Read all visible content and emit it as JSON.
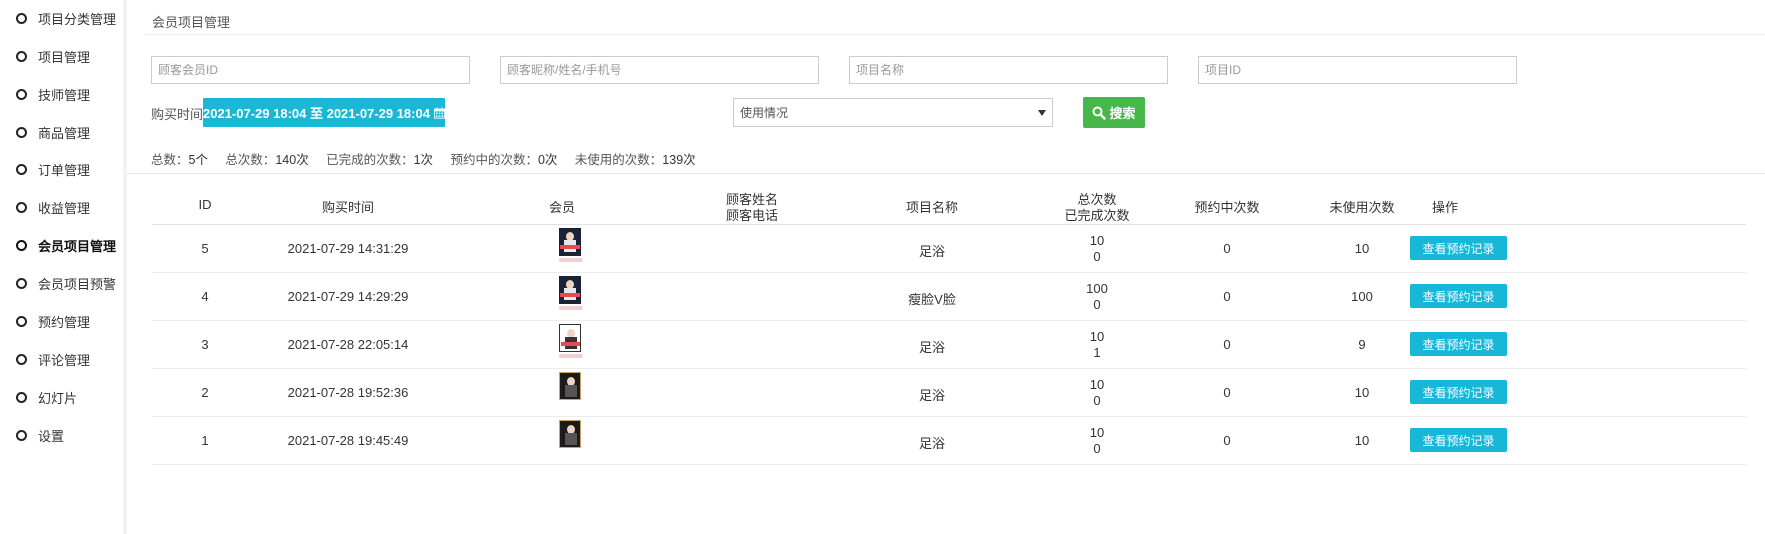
{
  "sidebar": {
    "items": [
      {
        "label": "项目分类管理",
        "active": false
      },
      {
        "label": "项目管理",
        "active": false
      },
      {
        "label": "技师管理",
        "active": false
      },
      {
        "label": "商品管理",
        "active": false
      },
      {
        "label": "订单管理",
        "active": false
      },
      {
        "label": "收益管理",
        "active": false
      },
      {
        "label": "会员项目管理",
        "active": true
      },
      {
        "label": "会员项目预警",
        "active": false
      },
      {
        "label": "预约管理",
        "active": false
      },
      {
        "label": "评论管理",
        "active": false
      },
      {
        "label": "幻灯片",
        "active": false
      },
      {
        "label": "设置",
        "active": false
      }
    ]
  },
  "page": {
    "title": "会员项目管理"
  },
  "filters": {
    "member_id_placeholder": "顾客会员ID",
    "customer_placeholder": "顾客昵称/姓名/手机号",
    "project_name_placeholder": "项目名称",
    "project_id_placeholder": "项目ID",
    "purchase_time_label": "购买时间",
    "date_range": "2021-07-29 18:04 至 2021-07-29 18:04",
    "usage_select": "使用情况",
    "search_label": "搜索"
  },
  "stats": [
    {
      "label": "总数：",
      "value": "5个"
    },
    {
      "label": "总次数：",
      "value": "140次"
    },
    {
      "label": "已完成的次数：",
      "value": "1次"
    },
    {
      "label": "预约中的次数：",
      "value": "0次"
    },
    {
      "label": "未使用的次数：",
      "value": "139次"
    }
  ],
  "table": {
    "headers": {
      "id": "ID",
      "purchase_time": "购买时间",
      "member": "会员",
      "customer_name": "顾客姓名",
      "customer_phone": "顾客电话",
      "project_name": "项目名称",
      "total_count": "总次数",
      "completed_count": "已完成次数",
      "reserving": "预约中次数",
      "unused": "未使用次数",
      "action": "操作"
    },
    "rows": [
      {
        "id": "5",
        "time": "2021-07-29 14:31:29",
        "project": "足浴",
        "total": "10",
        "completed": "0",
        "reserving": "0",
        "unused": "10",
        "action": "查看预约记录"
      },
      {
        "id": "4",
        "time": "2021-07-29 14:29:29",
        "project": "瘦脸V脸",
        "total": "100",
        "completed": "0",
        "reserving": "0",
        "unused": "100",
        "action": "查看预约记录"
      },
      {
        "id": "3",
        "time": "2021-07-28 22:05:14",
        "project": "足浴",
        "total": "10",
        "completed": "1",
        "reserving": "0",
        "unused": "9",
        "action": "查看预约记录"
      },
      {
        "id": "2",
        "time": "2021-07-28 19:52:36",
        "project": "足浴",
        "total": "10",
        "completed": "0",
        "reserving": "0",
        "unused": "10",
        "action": "查看预约记录"
      },
      {
        "id": "1",
        "time": "2021-07-28 19:45:49",
        "project": "足浴",
        "total": "10",
        "completed": "0",
        "reserving": "0",
        "unused": "10",
        "action": "查看预约记录"
      }
    ]
  },
  "colors": {
    "accent": "#1bb8d6",
    "search": "#46b74a"
  }
}
